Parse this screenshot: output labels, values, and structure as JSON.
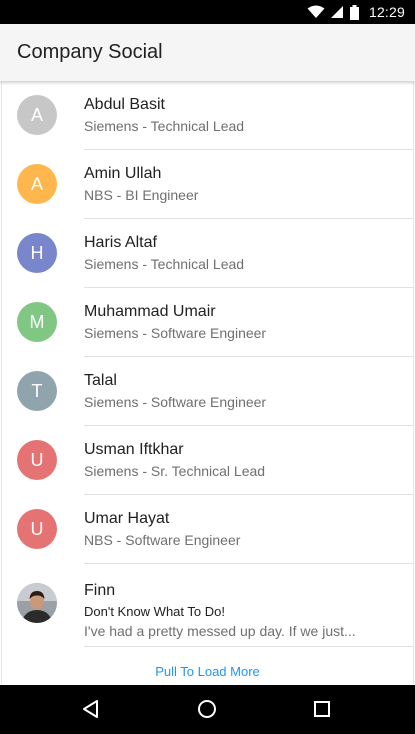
{
  "status_bar": {
    "time": "12:29"
  },
  "app_bar": {
    "title": "Company Social"
  },
  "contacts": [
    {
      "initial": "A",
      "name": "Abdul Basit",
      "subtitle": "Siemens - Technical Lead",
      "color": "#c7c7c7"
    },
    {
      "initial": "A",
      "name": "Amin Ullah",
      "subtitle": "NBS - BI Engineer",
      "color": "#ffb74d"
    },
    {
      "initial": "H",
      "name": "Haris Altaf",
      "subtitle": "Siemens - Technical Lead",
      "color": "#7986cb"
    },
    {
      "initial": "M",
      "name": "Muhammad Umair",
      "subtitle": "Siemens - Software Engineer",
      "color": "#81c784"
    },
    {
      "initial": "T",
      "name": "Talal",
      "subtitle": "Siemens - Software Engineer",
      "color": "#90a4ae"
    },
    {
      "initial": "U",
      "name": "Usman Iftkhar",
      "subtitle": "Siemens - Sr. Technical Lead",
      "color": "#e57373"
    },
    {
      "initial": "U",
      "name": "Umar Hayat",
      "subtitle": "NBS - Software Engineer",
      "color": "#e57373"
    }
  ],
  "message_item": {
    "name": "Finn",
    "title": "Don't Know What To Do!",
    "preview": "I've had a pretty messed up day. If we just..."
  },
  "load_more": "Pull To Load More",
  "nav": {
    "back_icon": "back-triangle-icon",
    "home_icon": "home-circle-icon",
    "recents_icon": "recents-square-icon"
  }
}
